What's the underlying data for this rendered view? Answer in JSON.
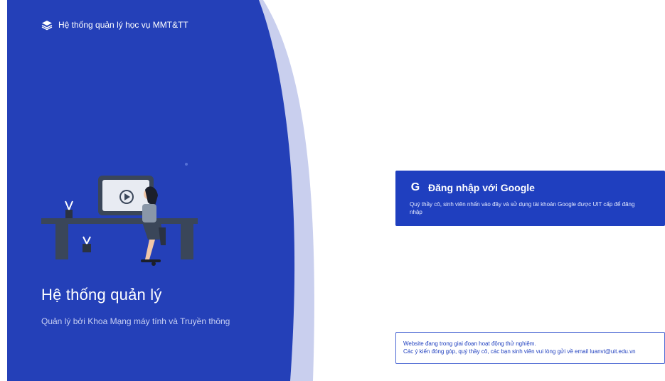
{
  "header": {
    "brand_icon": "layers-icon",
    "brand_text": "Hệ thống quản lý học vụ MMT&TT"
  },
  "hero": {
    "title": "Hệ thống quản lý",
    "subtitle": "Quản lý bởi Khoa Mạng máy tính và Truyền thông",
    "illustration": "person-at-desk-watching-video-illustration"
  },
  "login": {
    "icon": "google-icon",
    "icon_glyph": "G",
    "label": "Đăng nhập với Google",
    "description": "Quý thầy cô, sinh viên nhấn vào đây và sử dụng tài khoản Google được UIT cấp để đăng nhập"
  },
  "notice": {
    "line1": "Website đang trong giai đoạn hoạt động thử nghiệm.",
    "line2": "Các ý kiến đóng góp, quý thầy cô, các bạn sinh viên vui lòng gửi về email luanvt@uit.edu.vn"
  },
  "colors": {
    "primary": "#1f3fbf",
    "hero_blue": "#2440b8",
    "accent_band": "#c9cfee"
  }
}
